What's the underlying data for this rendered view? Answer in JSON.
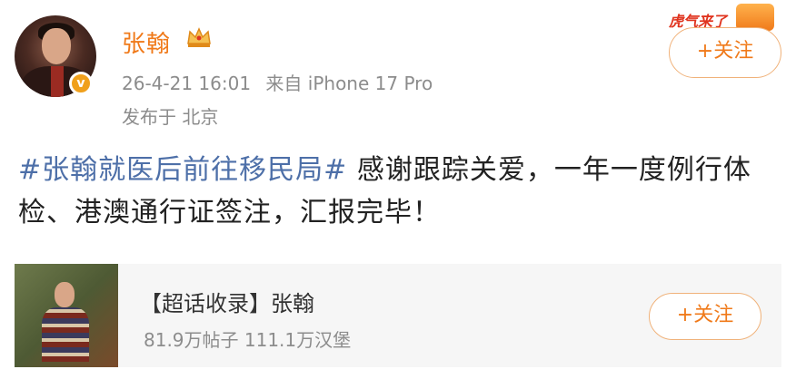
{
  "post": {
    "author": "张翰",
    "time": "26-4-21 16:01",
    "source": "来自 iPhone 17 Pro",
    "location": "发布于 北京",
    "follow_label": "+关注",
    "badge_text": "虎气来了",
    "hashtag": "#张翰就医后前往移民局#",
    "body": " 感谢跟踪关爱，一年一度例行体检、港澳通行证签注，汇报完毕！"
  },
  "card": {
    "title": "【超话收录】张翰",
    "stats": "81.9万帖子 111.1万汉堡",
    "follow_label": "+关注"
  },
  "colors": {
    "accent": "#f07a1a",
    "hashtag": "#4d6fa8",
    "meta": "#8c8c8c"
  }
}
